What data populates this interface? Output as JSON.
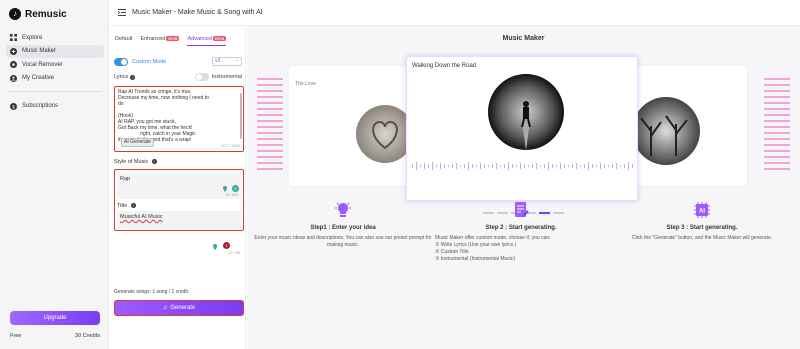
{
  "app": {
    "name": "Remusic",
    "logo_letter": "♪"
  },
  "sidebar": {
    "items": [
      {
        "label": "Explore",
        "icon": "grid-icon"
      },
      {
        "label": "Music Maker",
        "icon": "plus-circle-icon",
        "active": true
      },
      {
        "label": "Vocal Remover",
        "icon": "vocal-icon"
      },
      {
        "label": "My Creative",
        "icon": "person-icon"
      }
    ],
    "subscriptions": "Subscriptions",
    "upgrade_label": "Upgrade",
    "plan": "Free",
    "credits": "30 Credits"
  },
  "header": {
    "title": "Music Maker - Make Music & Song with AI"
  },
  "panel": {
    "tabs": [
      {
        "label": "Default"
      },
      {
        "label": "Enhanced",
        "badge": "Beta"
      },
      {
        "label": "Advanced",
        "badge": "Beta",
        "active": true
      }
    ],
    "custom_mode_label": "Custom Mode",
    "version": "v3",
    "lyrics_label": "Lyrics",
    "instrumental_label": "Instrumental",
    "lyrics_lines": [
      "Rap AI Trends so cringe, it's true,",
      "Decrease my time, now nothing I need to",
      "do",
      "",
      "(Hook)",
      "AI RAP, you got me stuck,",
      "Got Back my time, what the heck!",
      "                right, catch in your Magic",
      "it's a cool vibe, and that's a wrap!"
    ],
    "ai_generate_label": "AI Generate",
    "lyrics_count": "207 / 3000",
    "style_label": "Style of Music",
    "style_value": "Rap",
    "style_count": "3 / 120",
    "title_label": "Title",
    "title_value": "Musicful AI Music",
    "title_count": "17 / 80",
    "title_bubble": "1",
    "generate_info": "Generate songs: 1 song / 1 credit.",
    "generate_label": "Generate"
  },
  "main": {
    "title": "Music Maker",
    "carousel": {
      "left_title": "The Love",
      "center_title": "Walking Down the Road"
    },
    "steps": [
      {
        "title": "Step1 : Enter your idea",
        "icon": "bulb-icon",
        "text": "Enter your music ideas and descriptions. You can also use our preset prompt for making music."
      },
      {
        "title": "Step 2 : Start generating.",
        "icon": "document-edit-icon",
        "text": "Music Maker offer custom mode, choose if, you can:",
        "list": [
          "① Write Lyrics (Use your own lyrics )",
          "② Custom Title",
          "③ Instrumental (Instrumental Music)"
        ]
      },
      {
        "title": "Step 3 : Start generating.",
        "icon": "ai-chip-icon",
        "icon_text": "AI",
        "text": "Click the \"Generate\" button, and the Music Maker will generate."
      }
    ]
  },
  "colors": {
    "accent": "#7a3cf0",
    "highlight_border": "#d83a3a",
    "toggle": "#3a8ee6",
    "beta": "#e9546b"
  }
}
